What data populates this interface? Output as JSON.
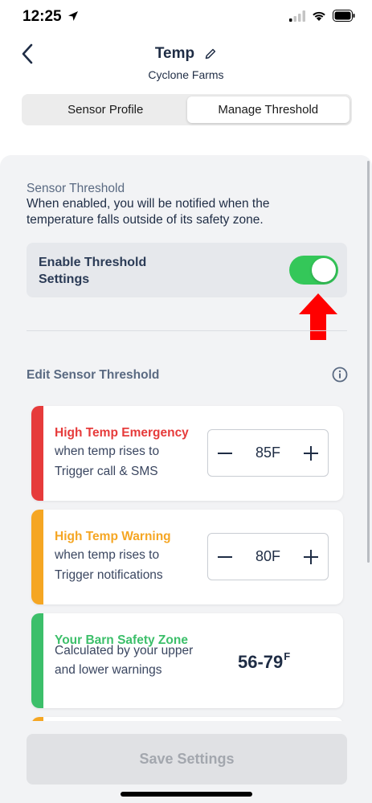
{
  "status_bar": {
    "time": "12:25"
  },
  "header": {
    "title": "Temp",
    "subtitle": "Cyclone Farms"
  },
  "tabs": [
    {
      "label": "Sensor Profile",
      "active": false
    },
    {
      "label": "Manage Threshold",
      "active": true
    }
  ],
  "sensor_threshold": {
    "title": "Sensor Threshold",
    "description": "When enabled, you will be notified when the temperature falls outside of its safety zone."
  },
  "enable": {
    "label": "Enable Threshold Settings",
    "on": true
  },
  "edit_section": {
    "title": "Edit Sensor Threshold"
  },
  "cards": [
    {
      "title": "High Temp Emergency",
      "line1": "when temp rises to",
      "line2": "Trigger call & SMS",
      "value": "85F",
      "color": "#e63b3b"
    },
    {
      "title": "High Temp Warning",
      "line1": "when temp rises to",
      "line2": "Trigger notifications",
      "value": "80F",
      "color": "#f5a623"
    },
    {
      "title": "Your Barn Safety Zone",
      "line1": "Calculated by your upper",
      "line2": "and lower warnings",
      "value": "56-79",
      "unit": "F",
      "color": "#3cbf6a"
    }
  ],
  "save_button": "Save Settings",
  "colors": {
    "toggle_on": "#34c759",
    "arrow": "#ff0000",
    "emergency": "#e63b3b",
    "warning": "#f5a623",
    "safe": "#3cbf6a"
  }
}
